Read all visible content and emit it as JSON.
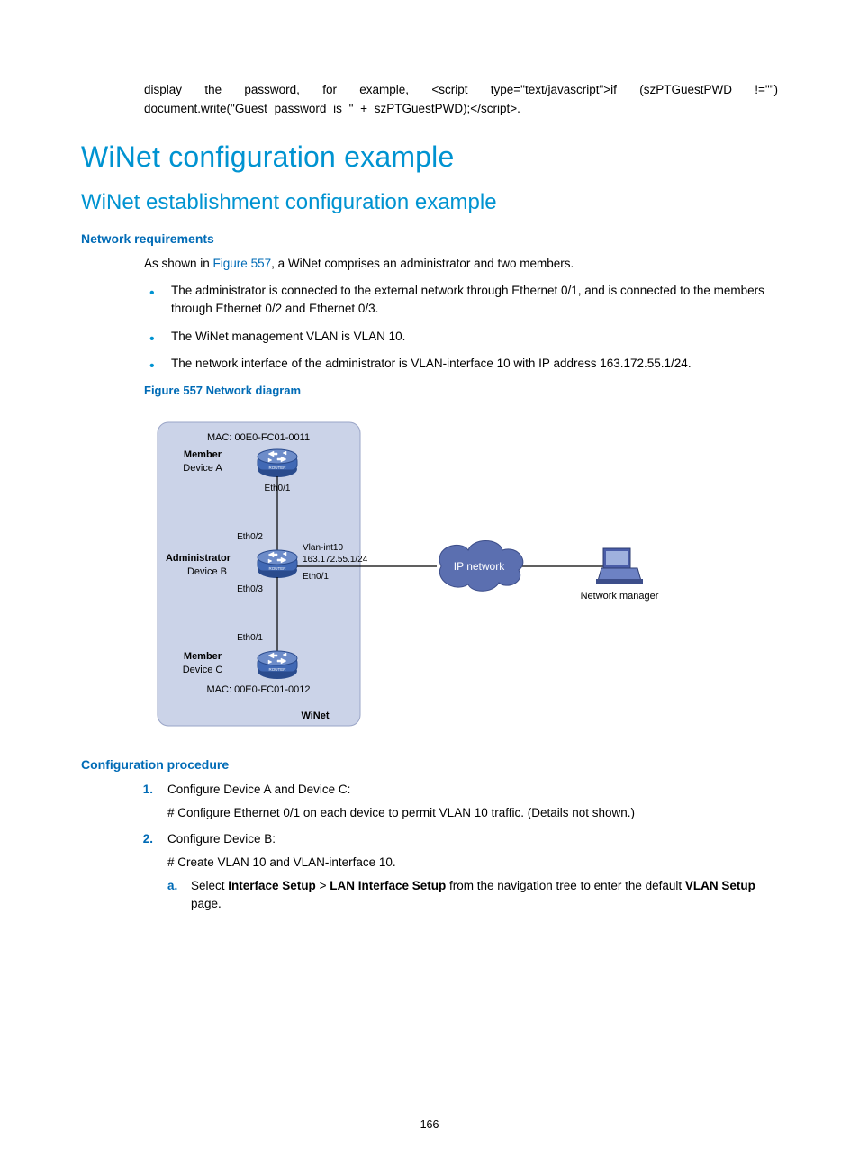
{
  "top_paragraph": "display the password, for example, <script type=\"text/javascript\">if (szPTGuestPWD !=\"\") document.write(\"Guest password is \" + szPTGuestPWD);</script>.",
  "heading_main": "WiNet configuration example",
  "heading_sub": "WiNet establishment configuration example",
  "heading_netreq": "Network requirements",
  "intro_prefix": "As shown in ",
  "intro_link": "Figure 557",
  "intro_suffix": ", a WiNet comprises an administrator and two members.",
  "bullets": [
    "The administrator is connected to the external network through Ethernet 0/1, and is connected to the members through Ethernet 0/2 and Ethernet 0/3.",
    "The WiNet management VLAN is VLAN 10.",
    "The network interface of the administrator is VLAN-interface 10 with IP address 163.172.55.1/24."
  ],
  "figure_caption": "Figure 557 Network diagram",
  "diagram": {
    "mac_top": "MAC: 00E0-FC01-0011",
    "member_a_role": "Member",
    "member_a_name": "Device A",
    "eth01_a": "Eth0/1",
    "eth02": "Eth0/2",
    "admin_role": "Administrator",
    "admin_name": "Device B",
    "vlan_int": "Vlan-int10",
    "vlan_ip": "163.172.55.1/24",
    "eth01_b": "Eth0/1",
    "eth03": "Eth0/3",
    "eth01_c": "Eth0/1",
    "member_c_role": "Member",
    "member_c_name": "Device C",
    "mac_bottom": "MAC: 00E0-FC01-0012",
    "winet_label": "WiNet",
    "cloud_label": "IP network",
    "manager_label": "Network manager",
    "router_text": "ROUTER"
  },
  "heading_confproc": "Configuration procedure",
  "steps": [
    {
      "num": "1.",
      "title": "Configure Device A and Device C:",
      "detail": "# Configure Ethernet 0/1 on each device to permit VLAN 10 traffic. (Details not shown.)"
    },
    {
      "num": "2.",
      "title": "Configure Device B:",
      "detail": "# Create VLAN 10 and VLAN-interface 10.",
      "substeps": [
        {
          "num": "a.",
          "prefix": "Select ",
          "bold1": "Interface Setup",
          "gt": " > ",
          "bold2": "LAN Interface Setup",
          "mid": " from the navigation tree to enter the default ",
          "bold3": "VLAN Setup",
          "suffix": " page."
        }
      ]
    }
  ],
  "page_number": "166"
}
